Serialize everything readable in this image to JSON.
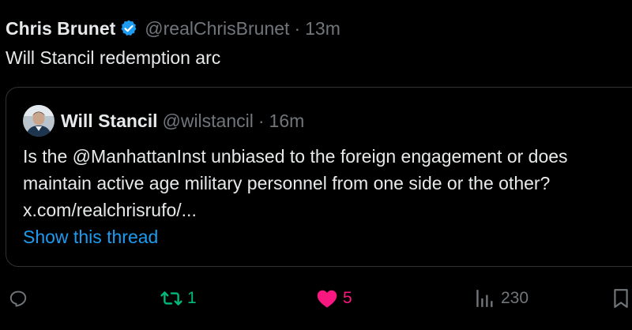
{
  "post": {
    "author_name": "Chris Brunet",
    "author_handle": "@realChrisBrunet",
    "separator": "·",
    "time": "13m",
    "text": "Will Stancil redemption arc"
  },
  "quote": {
    "author_name": "Will Stancil",
    "author_handle": "@wilstancil",
    "separator": "·",
    "time": "16m",
    "lines": [
      "Is the @ManhattanInst unbiased to the foreign engagement or does",
      "maintain active age military personnel from one side or the other?",
      "x.com/realchrisrufo/..."
    ],
    "show_thread": "Show this thread"
  },
  "actions": {
    "reply_icon": "reply-icon",
    "retweet_icon": "retweet-icon",
    "retweet_count": "1",
    "like_icon": "heart-icon",
    "like_count": "5",
    "views_icon": "views-icon",
    "views_count": "230"
  },
  "colors": {
    "background": "#000000",
    "text_primary": "#e7e9ea",
    "text_secondary": "#71767b",
    "link": "#1d9bf0",
    "retweet_active": "#00ba7c",
    "like_active": "#f91880",
    "verified_badge": "#1d9bf0",
    "border": "#2f3336"
  }
}
